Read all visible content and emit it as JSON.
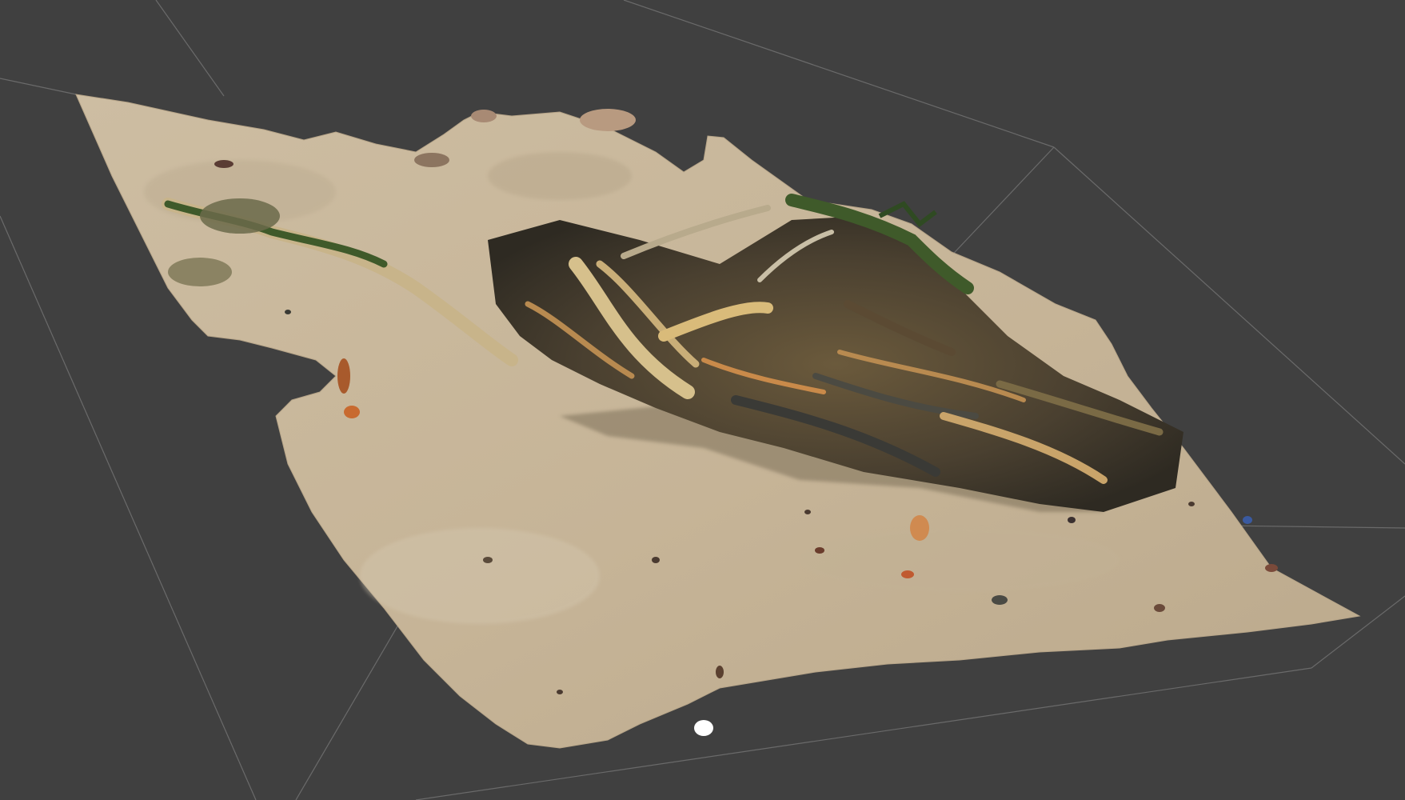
{
  "viewport": {
    "background_color": "#404040",
    "grid_line_color": "#6a6a6a",
    "model": {
      "subject": "beach-sand-scan-with-tangled-rope-and-seaweed",
      "sand_color": "#c9b89c",
      "sand_shadow_color": "#a8977c",
      "debris_colors": [
        "#2f2e24",
        "#7a6a45",
        "#c9a46a",
        "#b88a50",
        "#3d4a2a",
        "#5b4a33"
      ],
      "rope_color": "#d6c08c",
      "seaweed_color": "#3f5a2a"
    },
    "icons": {
      "bounding-box": "bounding-box-outline"
    }
  }
}
